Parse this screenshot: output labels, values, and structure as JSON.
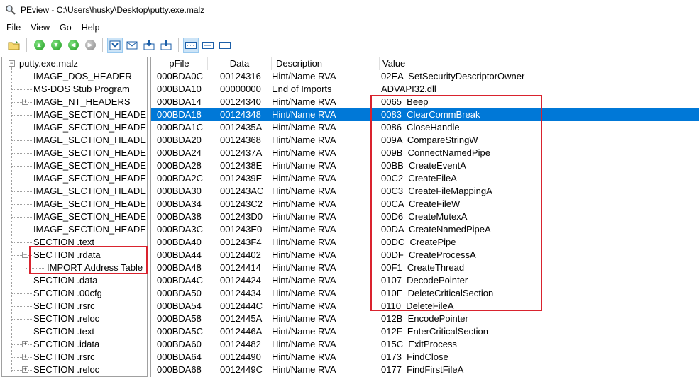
{
  "window": {
    "title": "PEview - C:\\Users\\husky\\Desktop\\putty.exe.malz",
    "app_icon": "magnifier-icon"
  },
  "menu": [
    "File",
    "View",
    "Go",
    "Help"
  ],
  "toolbar": {
    "buttons": [
      {
        "name": "open-folder-icon"
      },
      {
        "name": "nav-up-icon"
      },
      {
        "name": "nav-down-icon"
      },
      {
        "name": "nav-back-icon"
      },
      {
        "name": "nav-forward-icon"
      },
      {
        "name": "view-raw-icon"
      },
      {
        "name": "view-mail-icon"
      },
      {
        "name": "view-import-icon"
      },
      {
        "name": "view-export-icon"
      },
      {
        "name": "view-hex-icon"
      },
      {
        "name": "view-byte-icon"
      },
      {
        "name": "view-word-icon"
      }
    ]
  },
  "tree": {
    "root": "putty.exe.malz",
    "items": [
      {
        "label": "IMAGE_DOS_HEADER",
        "level": 1,
        "expander": ""
      },
      {
        "label": "MS-DOS Stub Program",
        "level": 1,
        "expander": ""
      },
      {
        "label": "IMAGE_NT_HEADERS",
        "level": 1,
        "expander": "+"
      },
      {
        "label": "IMAGE_SECTION_HEADE",
        "level": 1,
        "expander": ""
      },
      {
        "label": "IMAGE_SECTION_HEADE",
        "level": 1,
        "expander": ""
      },
      {
        "label": "IMAGE_SECTION_HEADE",
        "level": 1,
        "expander": ""
      },
      {
        "label": "IMAGE_SECTION_HEADE",
        "level": 1,
        "expander": ""
      },
      {
        "label": "IMAGE_SECTION_HEADE",
        "level": 1,
        "expander": ""
      },
      {
        "label": "IMAGE_SECTION_HEADE",
        "level": 1,
        "expander": ""
      },
      {
        "label": "IMAGE_SECTION_HEADE",
        "level": 1,
        "expander": ""
      },
      {
        "label": "IMAGE_SECTION_HEADE",
        "level": 1,
        "expander": ""
      },
      {
        "label": "IMAGE_SECTION_HEADE",
        "level": 1,
        "expander": ""
      },
      {
        "label": "IMAGE_SECTION_HEADE",
        "level": 1,
        "expander": ""
      },
      {
        "label": "SECTION .text",
        "level": 1,
        "expander": ""
      },
      {
        "label": "SECTION .rdata",
        "level": 1,
        "expander": "-"
      },
      {
        "label": "IMPORT Address Table",
        "level": 2,
        "expander": ""
      },
      {
        "label": "SECTION .data",
        "level": 1,
        "expander": ""
      },
      {
        "label": "SECTION .00cfg",
        "level": 1,
        "expander": ""
      },
      {
        "label": "SECTION .rsrc",
        "level": 1,
        "expander": ""
      },
      {
        "label": "SECTION .reloc",
        "level": 1,
        "expander": ""
      },
      {
        "label": "SECTION .text",
        "level": 1,
        "expander": ""
      },
      {
        "label": "SECTION .idata",
        "level": 1,
        "expander": "+"
      },
      {
        "label": "SECTION .rsrc",
        "level": 1,
        "expander": "+"
      },
      {
        "label": "SECTION .reloc",
        "level": 1,
        "expander": "+"
      }
    ]
  },
  "table": {
    "columns": [
      "pFile",
      "Data",
      "Description",
      "Value"
    ],
    "selected_row": 3,
    "rows": [
      {
        "pFile": "000BDA0C",
        "data": "00124316",
        "description": "Hint/Name RVA",
        "value": "02EA  SetSecurityDescriptorOwner"
      },
      {
        "pFile": "000BDA10",
        "data": "00000000",
        "description": "End of Imports",
        "value": "ADVAPI32.dll"
      },
      {
        "pFile": "000BDA14",
        "data": "00124340",
        "description": "Hint/Name RVA",
        "value": "0065  Beep"
      },
      {
        "pFile": "000BDA18",
        "data": "00124348",
        "description": "Hint/Name RVA",
        "value": "0083  ClearCommBreak"
      },
      {
        "pFile": "000BDA1C",
        "data": "0012435A",
        "description": "Hint/Name RVA",
        "value": "0086  CloseHandle"
      },
      {
        "pFile": "000BDA20",
        "data": "00124368",
        "description": "Hint/Name RVA",
        "value": "009A  CompareStringW"
      },
      {
        "pFile": "000BDA24",
        "data": "0012437A",
        "description": "Hint/Name RVA",
        "value": "009B  ConnectNamedPipe"
      },
      {
        "pFile": "000BDA28",
        "data": "0012438E",
        "description": "Hint/Name RVA",
        "value": "00BB  CreateEventA"
      },
      {
        "pFile": "000BDA2C",
        "data": "0012439E",
        "description": "Hint/Name RVA",
        "value": "00C2  CreateFileA"
      },
      {
        "pFile": "000BDA30",
        "data": "001243AC",
        "description": "Hint/Name RVA",
        "value": "00C3  CreateFileMappingA"
      },
      {
        "pFile": "000BDA34",
        "data": "001243C2",
        "description": "Hint/Name RVA",
        "value": "00CA  CreateFileW"
      },
      {
        "pFile": "000BDA38",
        "data": "001243D0",
        "description": "Hint/Name RVA",
        "value": "00D6  CreateMutexA"
      },
      {
        "pFile": "000BDA3C",
        "data": "001243E0",
        "description": "Hint/Name RVA",
        "value": "00DA  CreateNamedPipeA"
      },
      {
        "pFile": "000BDA40",
        "data": "001243F4",
        "description": "Hint/Name RVA",
        "value": "00DC  CreatePipe"
      },
      {
        "pFile": "000BDA44",
        "data": "00124402",
        "description": "Hint/Name RVA",
        "value": "00DF  CreateProcessA"
      },
      {
        "pFile": "000BDA48",
        "data": "00124414",
        "description": "Hint/Name RVA",
        "value": "00F1  CreateThread"
      },
      {
        "pFile": "000BDA4C",
        "data": "00124424",
        "description": "Hint/Name RVA",
        "value": "0107  DecodePointer"
      },
      {
        "pFile": "000BDA50",
        "data": "00124434",
        "description": "Hint/Name RVA",
        "value": "010E  DeleteCriticalSection"
      },
      {
        "pFile": "000BDA54",
        "data": "0012444C",
        "description": "Hint/Name RVA",
        "value": "0110  DeleteFileA"
      },
      {
        "pFile": "000BDA58",
        "data": "0012445A",
        "description": "Hint/Name RVA",
        "value": "012B  EncodePointer"
      },
      {
        "pFile": "000BDA5C",
        "data": "0012446A",
        "description": "Hint/Name RVA",
        "value": "012F  EnterCriticalSection"
      },
      {
        "pFile": "000BDA60",
        "data": "00124482",
        "description": "Hint/Name RVA",
        "value": "015C  ExitProcess"
      },
      {
        "pFile": "000BDA64",
        "data": "00124490",
        "description": "Hint/Name RVA",
        "value": "0173  FindClose"
      },
      {
        "pFile": "000BDA68",
        "data": "0012449C",
        "description": "Hint/Name RVA",
        "value": "0177  FindFirstFileA"
      }
    ]
  },
  "colors": {
    "selection": "#0078d7",
    "annotation": "#d9232e"
  }
}
